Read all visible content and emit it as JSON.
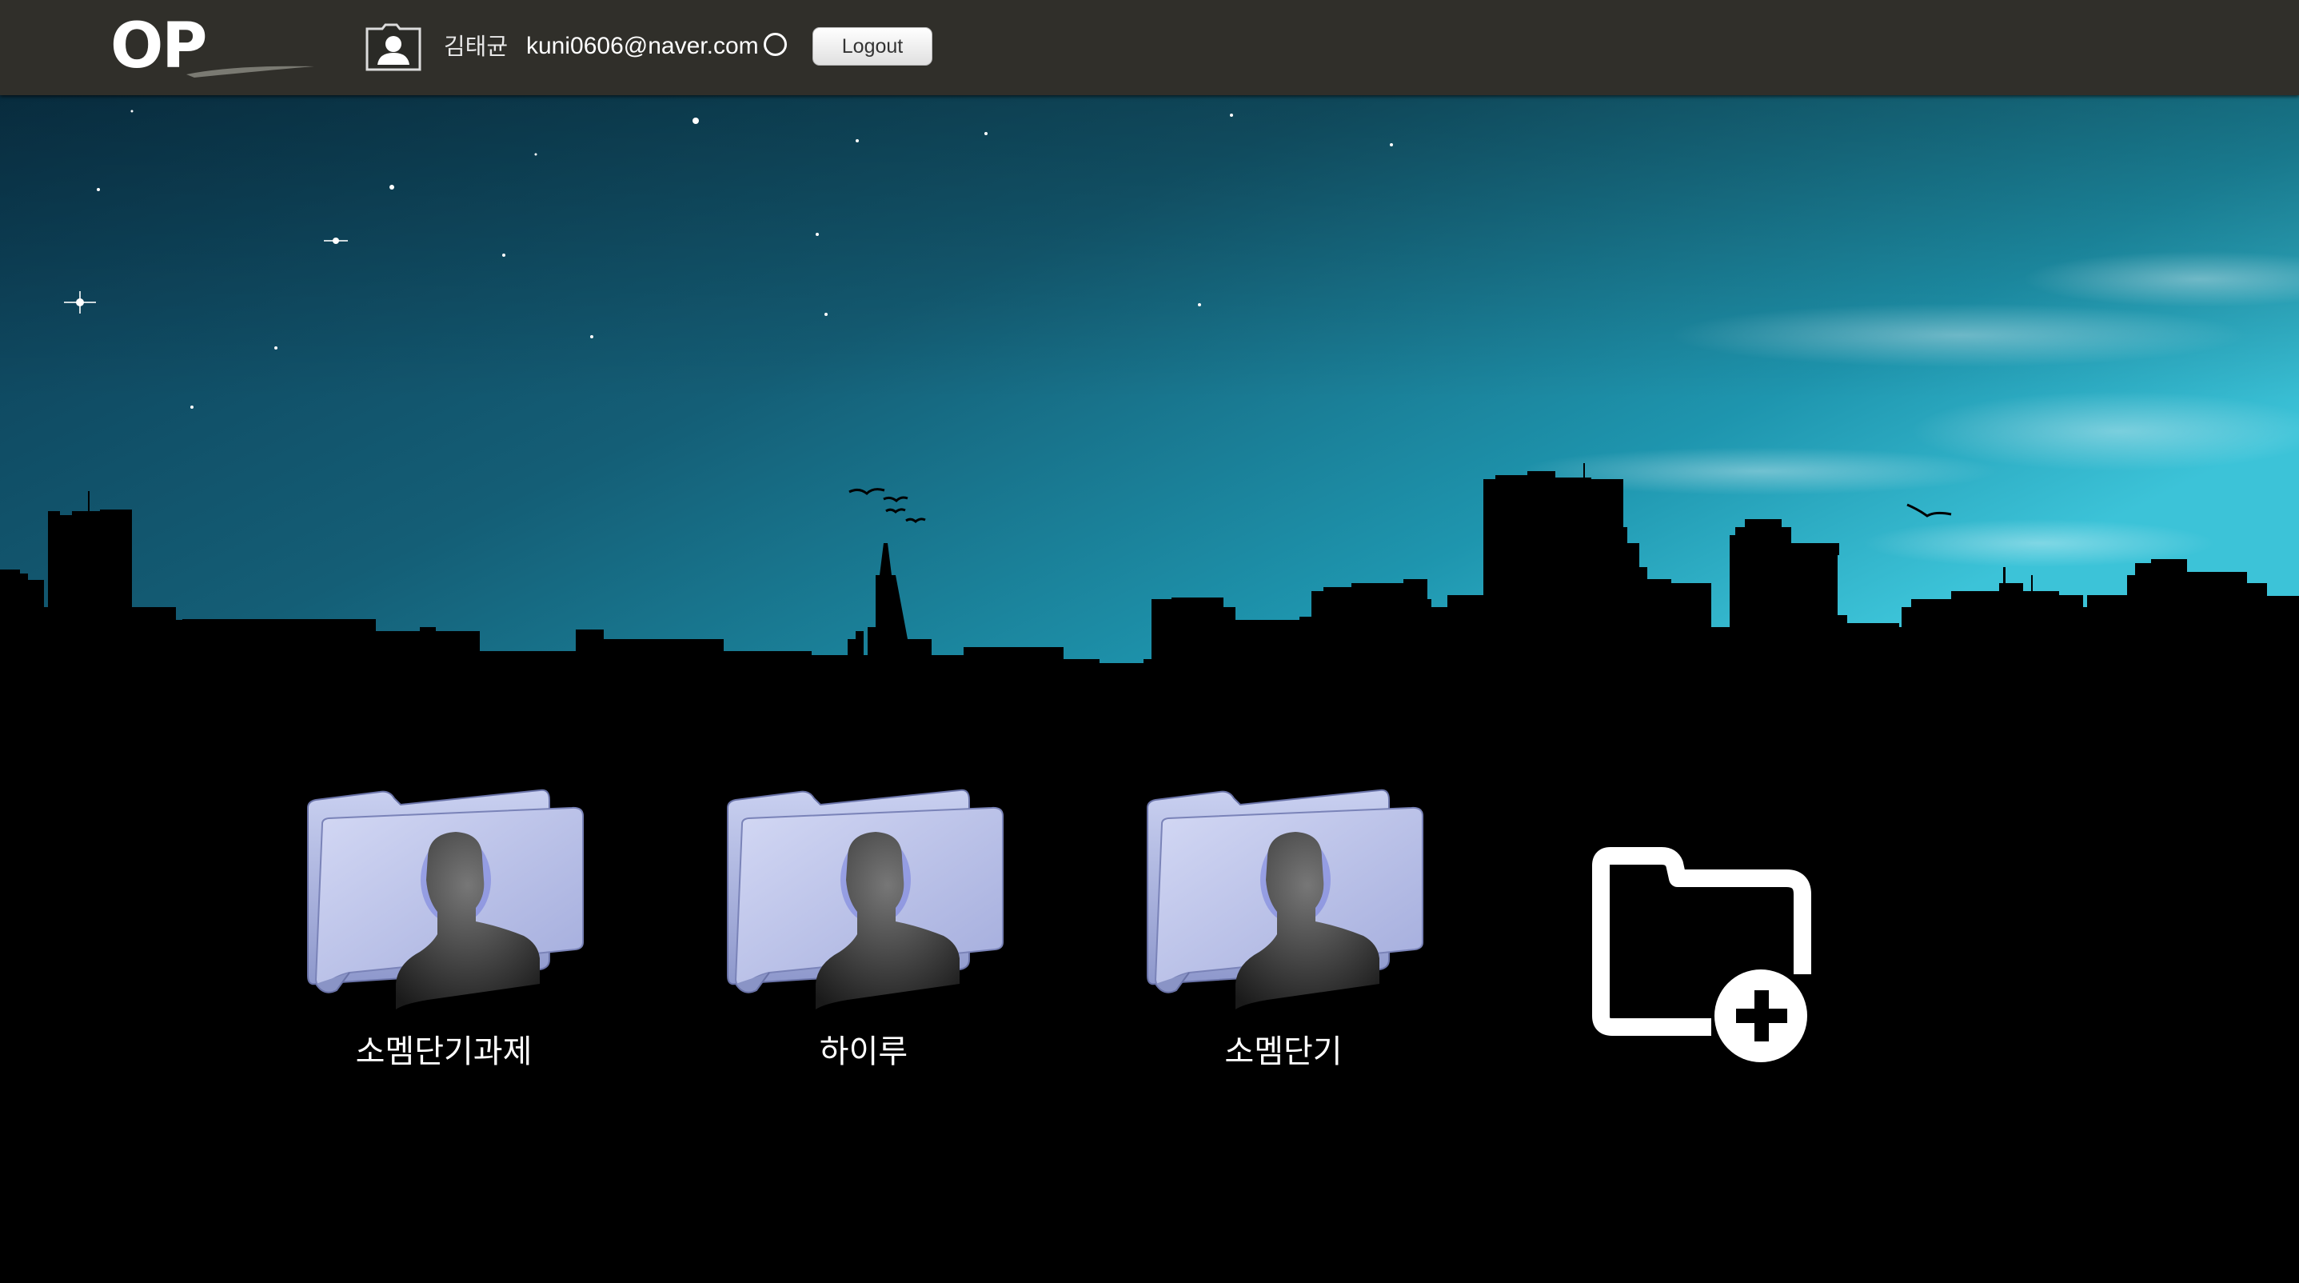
{
  "header": {
    "logo_text": "OP",
    "user_icon": "user-profile-icon",
    "user_name": "김태균",
    "user_email": "kuni0606@naver.com",
    "status_icon": "status-circle-icon",
    "logout_label": "Logout"
  },
  "folders": [
    {
      "label": "소멤단기과제",
      "icon": "user-folder-icon"
    },
    {
      "label": "하이루",
      "icon": "user-folder-icon"
    },
    {
      "label": "소멤단기",
      "icon": "user-folder-icon"
    }
  ],
  "add_folder": {
    "icon": "add-folder-icon"
  },
  "colors": {
    "topbar": "#302f2a",
    "sky_dark": "#0e4a60",
    "sky_light": "#2bb4cc",
    "folder_body": "#b3bbe6",
    "background": "#000000"
  }
}
